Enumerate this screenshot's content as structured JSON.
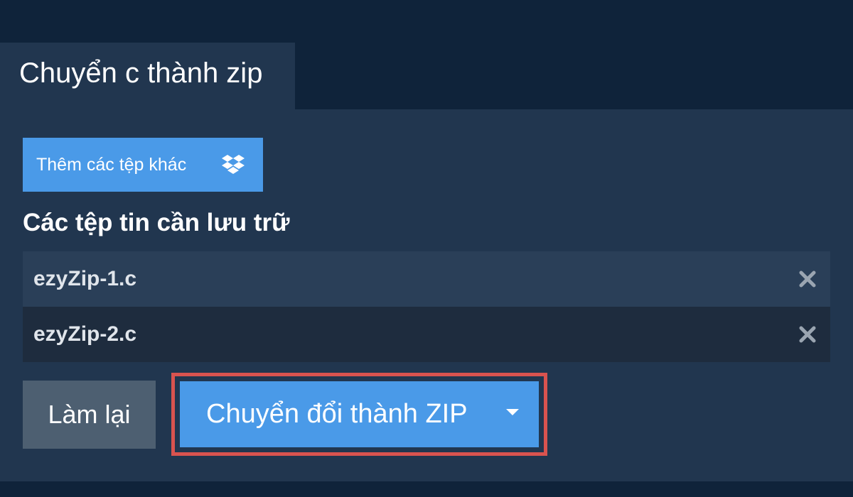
{
  "tab": {
    "title": "Chuyển c thành zip"
  },
  "add_files": {
    "label": "Thêm các tệp khác",
    "icon": "dropbox-icon"
  },
  "files_section": {
    "title": "Các tệp tin cần lưu trữ"
  },
  "files": [
    {
      "name": "ezyZip-1.c",
      "remove_icon": "close-icon"
    },
    {
      "name": "ezyZip-2.c",
      "remove_icon": "close-icon"
    }
  ],
  "actions": {
    "reset_label": "Làm lại",
    "convert_label": "Chuyển đổi thành ZIP",
    "convert_dropdown_icon": "caret-down-icon"
  },
  "colors": {
    "background": "#0f233a",
    "panel": "#21364f",
    "primary": "#4a9ae8",
    "secondary": "#4d5f71",
    "highlight": "#d9534f"
  }
}
